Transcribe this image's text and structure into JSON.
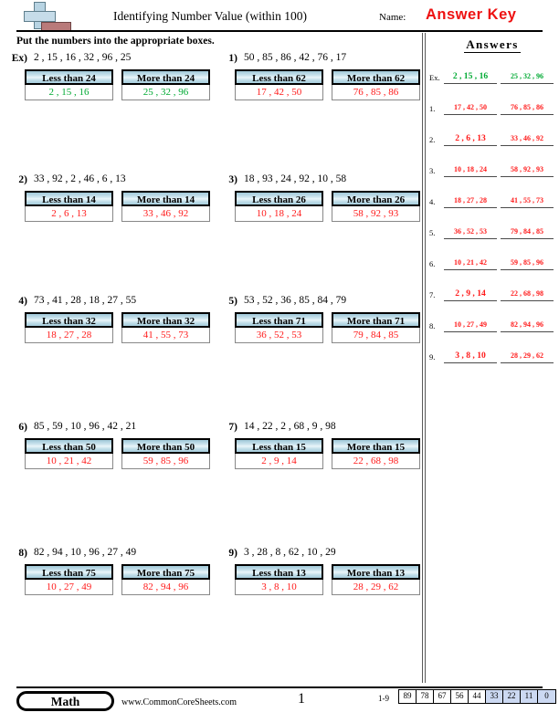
{
  "header": {
    "title": "Identifying Number Value (within 100)",
    "name_label": "Name:",
    "answer_key": "Answer Key",
    "logo_icon": "plus-block-logo"
  },
  "instruction": "Put the numbers into the appropriate boxes.",
  "colors": {
    "answer_red": "#ff1a1a",
    "answer_green": "#00aa33",
    "box_header_blue": "#bcdbe7",
    "score_highlight": "#ccd9f2"
  },
  "problems": [
    {
      "number": "Ex)",
      "given": "2 , 15 , 16 , 32 , 96 , 25",
      "less_label": "Less than 24",
      "more_label": "More than 24",
      "less_answer": "2 , 15 , 16",
      "more_answer": "25 , 32 , 96"
    },
    {
      "number": "1)",
      "given": "50 , 85 , 86 , 42 , 76 , 17",
      "less_label": "Less than 62",
      "more_label": "More than 62",
      "less_answer": "17 , 42 , 50",
      "more_answer": "76 , 85 , 86"
    },
    {
      "number": "2)",
      "given": "33 , 92 , 2 , 46 , 6 , 13",
      "less_label": "Less than 14",
      "more_label": "More than 14",
      "less_answer": "2 , 6 , 13",
      "more_answer": "33 , 46 , 92"
    },
    {
      "number": "3)",
      "given": "18 , 93 , 24 , 92 , 10 , 58",
      "less_label": "Less than 26",
      "more_label": "More than 26",
      "less_answer": "10 , 18 , 24",
      "more_answer": "58 , 92 , 93"
    },
    {
      "number": "4)",
      "given": "73 , 41 , 28 , 18 , 27 , 55",
      "less_label": "Less than 32",
      "more_label": "More than 32",
      "less_answer": "18 , 27 , 28",
      "more_answer": "41 , 55 , 73"
    },
    {
      "number": "5)",
      "given": "53 , 52 , 36 , 85 , 84 , 79",
      "less_label": "Less than 71",
      "more_label": "More than 71",
      "less_answer": "36 , 52 , 53",
      "more_answer": "79 , 84 , 85"
    },
    {
      "number": "6)",
      "given": "85 , 59 , 10 , 96 , 42 , 21",
      "less_label": "Less than 50",
      "more_label": "More than 50",
      "less_answer": "10 , 21 , 42",
      "more_answer": "59 , 85 , 96"
    },
    {
      "number": "7)",
      "given": "14 , 22 , 2 , 68 , 9 , 98",
      "less_label": "Less than 15",
      "more_label": "More than 15",
      "less_answer": "2 , 9 , 14",
      "more_answer": "22 , 68 , 98"
    },
    {
      "number": "8)",
      "given": "82 , 94 , 10 , 96 , 27 , 49",
      "less_label": "Less than 75",
      "more_label": "More than 75",
      "less_answer": "10 , 27 , 49",
      "more_answer": "82 , 94 , 96"
    },
    {
      "number": "9)",
      "given": "3 , 28 , 8 , 62 , 10 , 29",
      "less_label": "Less than 13",
      "more_label": "More than 13",
      "less_answer": "3 , 8 , 10",
      "more_answer": "28 , 29 , 62"
    }
  ],
  "answer_key_panel": {
    "title": "Answers",
    "rows": [
      {
        "label": "Ex.",
        "left": "2 , 15 , 16",
        "right": "25 , 32 , 96"
      },
      {
        "label": "1.",
        "left": "17 , 42 , 50",
        "right": "76 , 85 , 86"
      },
      {
        "label": "2.",
        "left": "2 , 6 , 13",
        "right": "33 , 46 , 92"
      },
      {
        "label": "3.",
        "left": "10 , 18 , 24",
        "right": "58 , 92 , 93"
      },
      {
        "label": "4.",
        "left": "18 , 27 , 28",
        "right": "41 , 55 , 73"
      },
      {
        "label": "5.",
        "left": "36 , 52 , 53",
        "right": "79 , 84 , 85"
      },
      {
        "label": "6.",
        "left": "10 , 21 , 42",
        "right": "59 , 85 , 96"
      },
      {
        "label": "7.",
        "left": "2 , 9 , 14",
        "right": "22 , 68 , 98"
      },
      {
        "label": "8.",
        "left": "10 , 27 , 49",
        "right": "82 , 94 , 96"
      },
      {
        "label": "9.",
        "left": "3 , 8 , 10",
        "right": "28 , 29 , 62"
      }
    ]
  },
  "footer": {
    "subject": "Math",
    "website": "www.CommonCoreSheets.com",
    "page_number": "1",
    "score_label": "1-9",
    "score_values": [
      "89",
      "78",
      "67",
      "56",
      "44",
      "33",
      "22",
      "11",
      "0"
    ],
    "score_highlight_from_index": 5
  }
}
